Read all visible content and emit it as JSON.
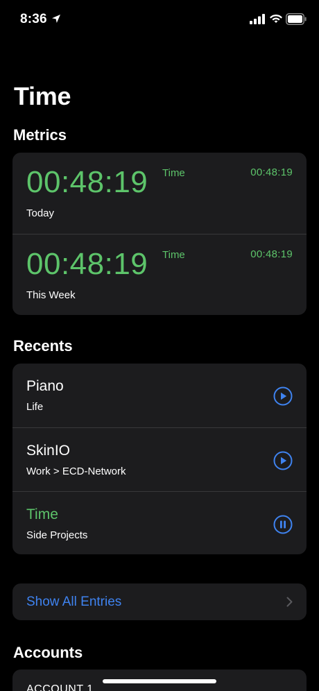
{
  "status_bar": {
    "time": "8:36",
    "icons": [
      "location-arrow-icon",
      "signal-icon",
      "wifi-icon",
      "battery-icon"
    ]
  },
  "page": {
    "title": "Time"
  },
  "metrics": {
    "section_title": "Metrics",
    "rows": [
      {
        "value": "00:48:19",
        "label": "Today",
        "side_label": "Time",
        "side_value": "00:48:19"
      },
      {
        "value": "00:48:19",
        "label": "This Week",
        "side_label": "Time",
        "side_value": "00:48:19"
      }
    ]
  },
  "recents": {
    "section_title": "Recents",
    "items": [
      {
        "title": "Piano",
        "subtitle": "Life",
        "state": "play",
        "active": false
      },
      {
        "title": "SkinIO",
        "subtitle": "Work > ECD-Network",
        "state": "play",
        "active": false
      },
      {
        "title": "Time",
        "subtitle": "Side Projects",
        "state": "pause",
        "active": true
      }
    ]
  },
  "entries": {
    "show_all_label": "Show All Entries"
  },
  "accounts": {
    "section_title": "Accounts",
    "first_account": "ACCOUNT 1"
  },
  "colors": {
    "accent_green": "#5dc46a",
    "accent_blue": "#3f83f0",
    "card": "#1c1c1e",
    "background": "#000000"
  }
}
